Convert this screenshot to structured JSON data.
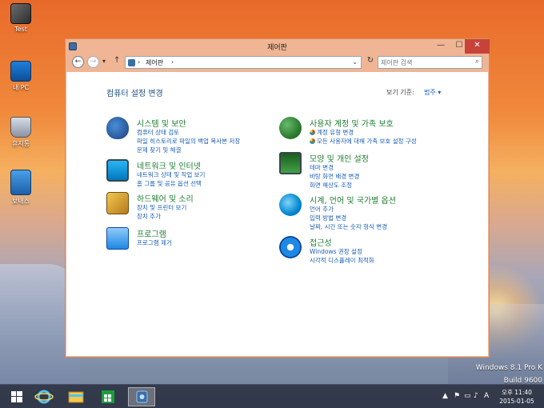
{
  "desktop": {
    "icons": [
      {
        "label": "Test"
      },
      {
        "label": "내 PC"
      },
      {
        "label": "휴지통"
      },
      {
        "label": "보내스"
      }
    ],
    "watermark_line1": "Windows 8.1 Pro K",
    "watermark_line2": "Build 9600"
  },
  "window": {
    "title": "제어판",
    "address": "제어판",
    "search_placeholder": "제어판 검색"
  },
  "content": {
    "heading": "컴퓨터 설정 변경",
    "view_by_label": "보기 기준:",
    "view_by_value": "범주 ▾",
    "categories": [
      {
        "title": "시스템 및 보안",
        "links": [
          "컴퓨터 상태 검토",
          "파일 히스토리로 파일의 백업 복사본 저장",
          "문제 찾기 및 해결"
        ]
      },
      {
        "title": "네트워크 및 인터넷",
        "links": [
          "네트워크 상태 및 작업 보기",
          "홈 그룹 및 공유 옵션 선택"
        ]
      },
      {
        "title": "하드웨어 및 소리",
        "links": [
          "장치 및 프린터 보기",
          "장치 추가"
        ]
      },
      {
        "title": "프로그램",
        "links": [
          "프로그램 제거"
        ]
      },
      {
        "title": "사용자 계정 및 가족 보호",
        "links": [
          "계정 유형 변경",
          "모든 사용자에 대해 가족 보호 설정 구성"
        ]
      },
      {
        "title": "모양 및 개인 설정",
        "links": [
          "테마 변경",
          "바탕 화면 배경 변경",
          "화면 해상도 조정"
        ]
      },
      {
        "title": "시계, 언어 및 국가별 옵션",
        "links": [
          "언어 추가",
          "입력 방법 변경",
          "날짜, 시간 또는 숫자 형식 변경"
        ]
      },
      {
        "title": "접근성",
        "links": [
          "Windows 권장 설정",
          "시각적 디스플레이 최적화"
        ]
      }
    ]
  },
  "taskbar": {
    "ime": "A",
    "time": "오후 11:40",
    "date": "2015-01-05"
  }
}
